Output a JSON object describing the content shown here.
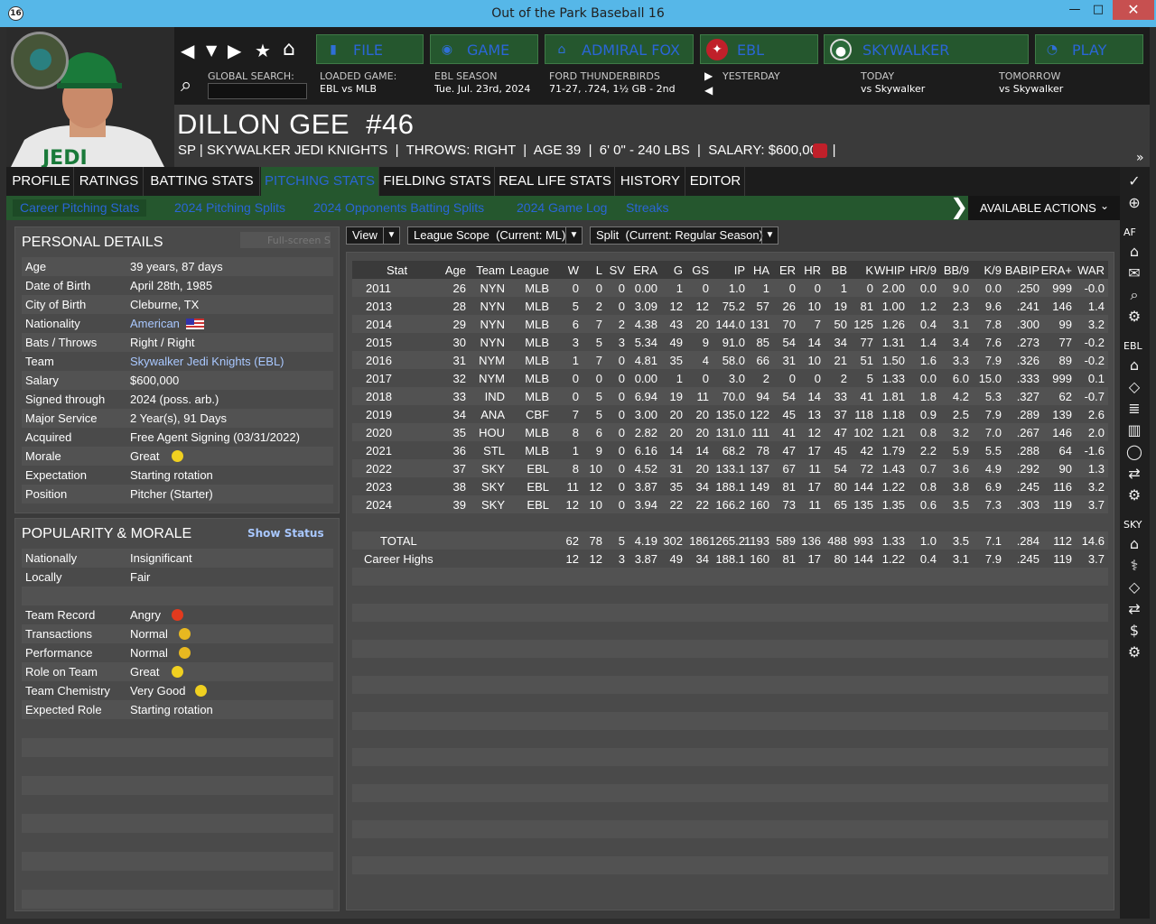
{
  "window": {
    "title": "Out of the Park Baseball 16",
    "icon": "16",
    "minimize": "—",
    "maximize": "□",
    "close": "✕"
  },
  "nav": {
    "buttons": [
      {
        "label": "FILE",
        "icon": "file-icon"
      },
      {
        "label": "GAME",
        "icon": "game-icon"
      },
      {
        "label": "ADMIRAL FOX",
        "icon": "home-icon"
      },
      {
        "label": "EBL",
        "icon": "league-logo-icon"
      },
      {
        "label": "SKYWALKER",
        "icon": "team-logo-icon"
      },
      {
        "label": "PLAY",
        "icon": "play-icon"
      }
    ],
    "global_search_label": "GLOBAL SEARCH:",
    "loaded_game_label": "LOADED GAME:",
    "loaded_game_value": "EBL vs MLB",
    "season_label": "EBL SEASON",
    "season_value": "Tue. Jul. 23rd, 2024",
    "team_label": "FORD THUNDERBIRDS",
    "team_value": "71-27, .724, 1½ GB - 2nd",
    "yesterday_label": "YESTERDAY",
    "today_label": "TODAY",
    "today_value": "vs Skywalker",
    "tomorrow_label": "TOMORROW",
    "tomorrow_value": "vs Skywalker"
  },
  "player": {
    "name": "DILLON GEE  #46",
    "summary": "SP | SKYWALKER JEDI KNIGHTS  |  THROWS: RIGHT  |  AGE 39  |  6' 0\" - 240 LBS  |  SALARY: $600,000  |",
    "photo_logo": "SKYWALKER JEDI KNIGHTS",
    "jersey": "JEDI"
  },
  "tabs": [
    "PROFILE",
    "RATINGS",
    "BATTING STATS",
    "PITCHING STATS",
    "FIELDING STATS",
    "REAL LIFE STATS",
    "HISTORY",
    "EDITOR"
  ],
  "subtabs": [
    "Career Pitching Stats",
    "2024 Pitching Splits",
    "2024 Opponents Batting Splits",
    "2024 Game Log",
    "Streaks"
  ],
  "available_actions": "AVAILABLE ACTIONS",
  "sidebar": {
    "af": "AF",
    "ebl": "EBL",
    "sky": "SKY"
  },
  "personal": {
    "title": "PERSONAL DETAILS",
    "fullscreen": "Full-screen Sel",
    "rows": [
      {
        "k": "Age",
        "v": "39 years, 87 days"
      },
      {
        "k": "Date of Birth",
        "v": "April 28th, 1985"
      },
      {
        "k": "City of Birth",
        "v": "Cleburne, TX"
      },
      {
        "k": "Nationality",
        "v": "American"
      },
      {
        "k": "Bats / Throws",
        "v": "Right / Right"
      },
      {
        "k": "Team",
        "v": "Skywalker Jedi Knights (EBL)"
      },
      {
        "k": "Salary",
        "v": "$600,000"
      },
      {
        "k": "Signed through",
        "v": "2024 (poss. arb.)"
      },
      {
        "k": "Major Service",
        "v": "2 Year(s), 91 Days"
      },
      {
        "k": "Acquired",
        "v": "Free Agent Signing (03/31/2022)"
      },
      {
        "k": "Morale",
        "v": "Great"
      },
      {
        "k": "Expectation",
        "v": "Starting rotation"
      },
      {
        "k": "Position",
        "v": "Pitcher (Starter)"
      }
    ]
  },
  "popularity": {
    "title": "POPULARITY & MORALE",
    "show_status": "Show Status",
    "rows": [
      {
        "k": "Nationally",
        "v": "Insignificant",
        "mood": ""
      },
      {
        "k": "Locally",
        "v": "Fair",
        "mood": ""
      },
      {
        "k": "",
        "v": "",
        "mood": ""
      },
      {
        "k": "Team Record",
        "v": "Angry",
        "mood": "#e23a1e"
      },
      {
        "k": "Transactions",
        "v": "Normal",
        "mood": "#e8b820"
      },
      {
        "k": "Performance",
        "v": "Normal",
        "mood": "#e8b820"
      },
      {
        "k": "Role on Team",
        "v": "Great",
        "mood": "#f0d020"
      },
      {
        "k": "Team Chemistry",
        "v": "Very Good",
        "mood": "#f0d020"
      },
      {
        "k": "Expected Role",
        "v": "Starting rotation",
        "mood": ""
      }
    ]
  },
  "filters": {
    "view": "View",
    "scope": "League Scope  (Current: ML)",
    "split": "Split  (Current: Regular Season)"
  },
  "stats": {
    "columns": [
      "Stat",
      "Age",
      "Team",
      "League",
      "W",
      "L",
      "SV",
      "ERA",
      "G",
      "GS",
      "IP",
      "HA",
      "ER",
      "HR",
      "BB",
      "K",
      "WHIP",
      "HR/9",
      "BB/9",
      "K/9",
      "BABIP",
      "ERA+",
      "WAR"
    ],
    "rows": [
      [
        "2011",
        "26",
        "NYN",
        "MLB",
        "0",
        "0",
        "0",
        "0.00",
        "1",
        "0",
        "1.0",
        "1",
        "0",
        "0",
        "1",
        "0",
        "2.00",
        "0.0",
        "9.0",
        "0.0",
        ".250",
        "999",
        "-0.0"
      ],
      [
        "2013",
        "28",
        "NYN",
        "MLB",
        "5",
        "2",
        "0",
        "3.09",
        "12",
        "12",
        "75.2",
        "57",
        "26",
        "10",
        "19",
        "81",
        "1.00",
        "1.2",
        "2.3",
        "9.6",
        ".241",
        "146",
        "1.4"
      ],
      [
        "2014",
        "29",
        "NYN",
        "MLB",
        "6",
        "7",
        "2",
        "4.38",
        "43",
        "20",
        "144.0",
        "131",
        "70",
        "7",
        "50",
        "125",
        "1.26",
        "0.4",
        "3.1",
        "7.8",
        ".300",
        "99",
        "3.2"
      ],
      [
        "2015",
        "30",
        "NYN",
        "MLB",
        "3",
        "5",
        "3",
        "5.34",
        "49",
        "9",
        "91.0",
        "85",
        "54",
        "14",
        "34",
        "77",
        "1.31",
        "1.4",
        "3.4",
        "7.6",
        ".273",
        "77",
        "-0.2"
      ],
      [
        "2016",
        "31",
        "NYM",
        "MLB",
        "1",
        "7",
        "0",
        "4.81",
        "35",
        "4",
        "58.0",
        "66",
        "31",
        "10",
        "21",
        "51",
        "1.50",
        "1.6",
        "3.3",
        "7.9",
        ".326",
        "89",
        "-0.2"
      ],
      [
        "2017",
        "32",
        "NYM",
        "MLB",
        "0",
        "0",
        "0",
        "0.00",
        "1",
        "0",
        "3.0",
        "2",
        "0",
        "0",
        "2",
        "5",
        "1.33",
        "0.0",
        "6.0",
        "15.0",
        ".333",
        "999",
        "0.1"
      ],
      [
        "2018",
        "33",
        "IND",
        "MLB",
        "0",
        "5",
        "0",
        "6.94",
        "19",
        "11",
        "70.0",
        "94",
        "54",
        "14",
        "33",
        "41",
        "1.81",
        "1.8",
        "4.2",
        "5.3",
        ".327",
        "62",
        "-0.7"
      ],
      [
        "2019",
        "34",
        "ANA",
        "CBF",
        "7",
        "5",
        "0",
        "3.00",
        "20",
        "20",
        "135.0",
        "122",
        "45",
        "13",
        "37",
        "118",
        "1.18",
        "0.9",
        "2.5",
        "7.9",
        ".289",
        "139",
        "2.6"
      ],
      [
        "2020",
        "35",
        "HOU",
        "MLB",
        "8",
        "6",
        "0",
        "2.82",
        "20",
        "20",
        "131.0",
        "111",
        "41",
        "12",
        "47",
        "102",
        "1.21",
        "0.8",
        "3.2",
        "7.0",
        ".267",
        "146",
        "2.0"
      ],
      [
        "2021",
        "36",
        "STL",
        "MLB",
        "1",
        "9",
        "0",
        "6.16",
        "14",
        "14",
        "68.2",
        "78",
        "47",
        "17",
        "45",
        "42",
        "1.79",
        "2.2",
        "5.9",
        "5.5",
        ".288",
        "64",
        "-1.6"
      ],
      [
        "2022",
        "37",
        "SKY",
        "EBL",
        "8",
        "10",
        "0",
        "4.52",
        "31",
        "20",
        "133.1",
        "137",
        "67",
        "11",
        "54",
        "72",
        "1.43",
        "0.7",
        "3.6",
        "4.9",
        ".292",
        "90",
        "1.3"
      ],
      [
        "2023",
        "38",
        "SKY",
        "EBL",
        "11",
        "12",
        "0",
        "3.87",
        "35",
        "34",
        "188.1",
        "149",
        "81",
        "17",
        "80",
        "144",
        "1.22",
        "0.8",
        "3.8",
        "6.9",
        ".245",
        "116",
        "3.2"
      ],
      [
        "2024",
        "39",
        "SKY",
        "EBL",
        "12",
        "10",
        "0",
        "3.94",
        "22",
        "22",
        "166.2",
        "160",
        "73",
        "11",
        "65",
        "135",
        "1.35",
        "0.6",
        "3.5",
        "7.3",
        ".303",
        "119",
        "3.7"
      ]
    ],
    "total": [
      "TOTAL",
      "",
      "",
      "",
      "62",
      "78",
      "5",
      "4.19",
      "302",
      "186",
      "1265.2",
      "1193",
      "589",
      "136",
      "488",
      "993",
      "1.33",
      "1.0",
      "3.5",
      "7.1",
      ".284",
      "112",
      "14.6"
    ],
    "highs": [
      "Career Highs",
      "",
      "",
      "",
      "12",
      "12",
      "3",
      "3.87",
      "49",
      "34",
      "188.1",
      "160",
      "81",
      "17",
      "80",
      "144",
      "1.22",
      "0.4",
      "3.1",
      "7.9",
      ".245",
      "119",
      "3.7"
    ]
  }
}
